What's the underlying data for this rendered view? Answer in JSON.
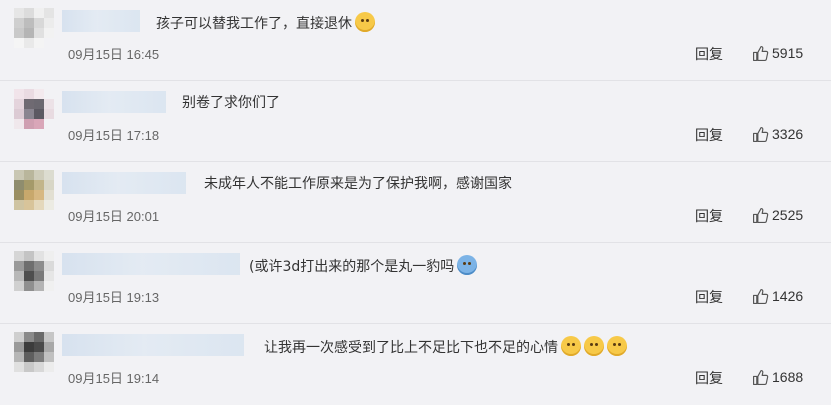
{
  "comments": [
    {
      "text": "孩子可以替我工作了，直接退休",
      "emoji_count": 1,
      "emoji_color": "yellow",
      "date": "09月15日 16:45",
      "reply_label": "回复",
      "likes": "5915"
    },
    {
      "text": "别卷了求你们了",
      "emoji_count": 0,
      "emoji_color": "",
      "date": "09月15日 17:18",
      "reply_label": "回复",
      "likes": "3326"
    },
    {
      "text": "未成年人不能工作原来是为了保护我啊，感谢国家",
      "emoji_count": 0,
      "emoji_color": "",
      "date": "09月15日 20:01",
      "reply_label": "回复",
      "likes": "2525"
    },
    {
      "text": "(或许3d打出来的那个是丸一豹吗",
      "emoji_count": 1,
      "emoji_color": "blue",
      "date": "09月15日 19:13",
      "reply_label": "回复",
      "likes": "1426"
    },
    {
      "text": "让我再一次感受到了比上不足比下也不足的心情",
      "emoji_count": 3,
      "emoji_color": "yellow",
      "date": "09月15日 19:14",
      "reply_label": "回复",
      "likes": "1688"
    }
  ],
  "icons": {
    "like": "thumbs-up-icon",
    "emoji": "doge-emoji-icon"
  },
  "colors": {
    "background": "#f2f2f5",
    "text": "#333333",
    "date": "#666666",
    "username_blur": "#d9e4f0"
  }
}
